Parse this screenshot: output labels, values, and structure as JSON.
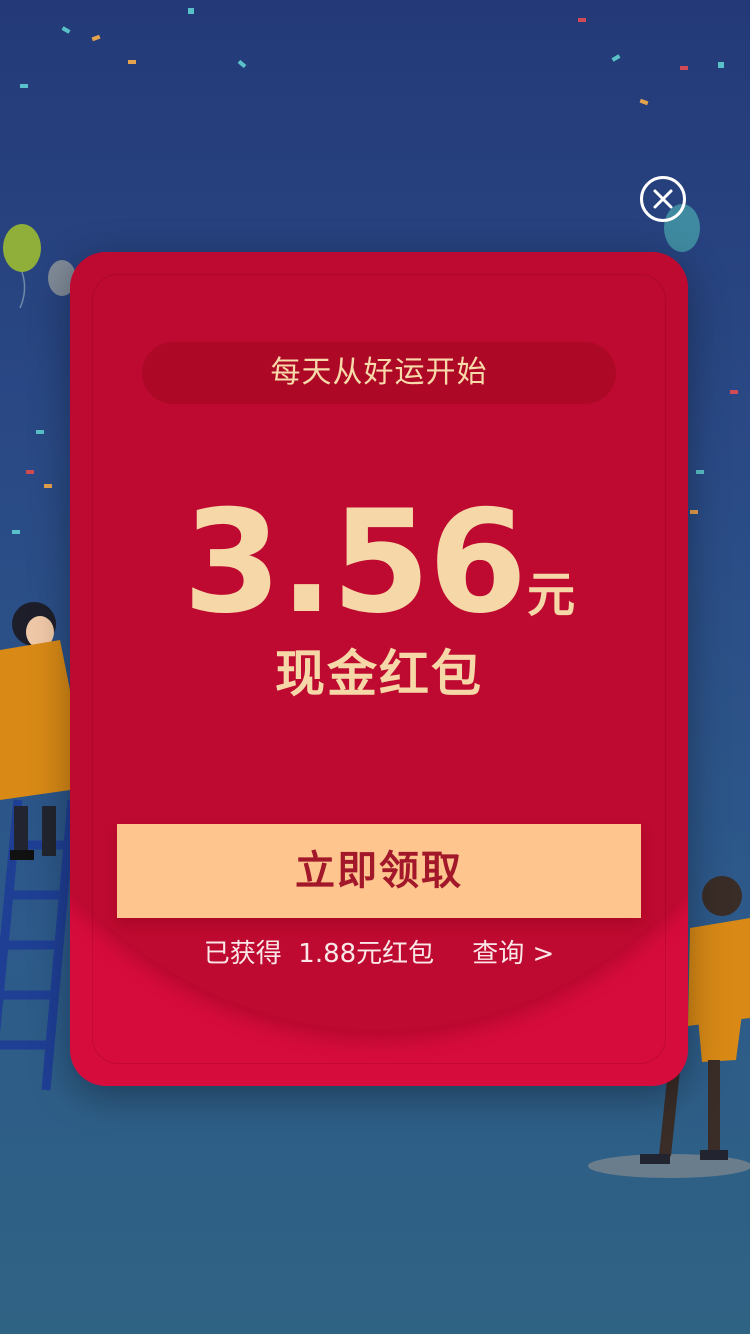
{
  "popup": {
    "slogan": "每天从好运开始",
    "amount": "3.56",
    "unit": "元",
    "packet_label": "现金红包",
    "claim_button": "立即领取",
    "earned_prefix": "已获得",
    "earned_amount": "1.88元红包",
    "query_link": "查询 >"
  },
  "colors": {
    "background": "#243a78",
    "card": "#d60c3c",
    "card_top": "#be0a30",
    "gold_text": "#f6d8a8",
    "button": "#ffc58f",
    "button_text": "#a2182a"
  },
  "icons": {
    "close": "close-circle-icon"
  }
}
